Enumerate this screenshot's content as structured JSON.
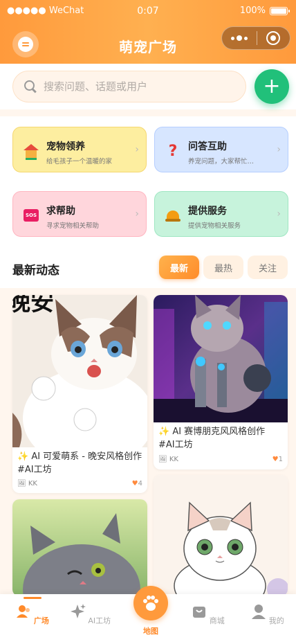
{
  "status": {
    "carrier": "●●●●● WeChat",
    "time": "0:07",
    "battery": "100%"
  },
  "header": {
    "title": "萌宠广场"
  },
  "search": {
    "placeholder": "搜索问题、话题或用户",
    "add_label": "+"
  },
  "cards": [
    {
      "title": "宠物领养",
      "subtitle": "给毛孩子一个温暖的家",
      "icon": "house-icon"
    },
    {
      "title": "问答互助",
      "subtitle": "养宠问题，大家帮忙…",
      "icon": "question-icon"
    },
    {
      "title": "求帮助",
      "subtitle": "寻求宠物相关帮助",
      "icon": "sos-icon"
    },
    {
      "title": "提供服务",
      "subtitle": "提供宠物相关服务",
      "icon": "service-bell-icon"
    }
  ],
  "section": {
    "title": "最新动态"
  },
  "tabs": [
    {
      "label": "最新"
    },
    {
      "label": "最热"
    },
    {
      "label": "关注"
    }
  ],
  "posts": [
    {
      "caption": "✨ AI 可爱萌系 - 晚安风格创作 #AI工坊",
      "author": "KK",
      "likes": "4",
      "image_text": "晚安"
    },
    {
      "caption": "✨ AI 赛博朋克风风格创作 #AI工坊",
      "author": "KK",
      "likes": "1"
    },
    {
      "caption": "",
      "author": "",
      "likes": ""
    },
    {
      "caption": "",
      "author": "",
      "likes": ""
    }
  ],
  "tabbar": [
    {
      "label": "广场",
      "icon": "person-icon"
    },
    {
      "label": "AI工坊",
      "icon": "sparkle-icon"
    },
    {
      "label": "地图",
      "icon": "paw-icon"
    },
    {
      "label": "商城",
      "icon": "bag-icon"
    },
    {
      "label": "我的",
      "icon": "profile-icon"
    }
  ],
  "colors": {
    "accent": "#ff9a3c",
    "green": "#21c07a"
  }
}
